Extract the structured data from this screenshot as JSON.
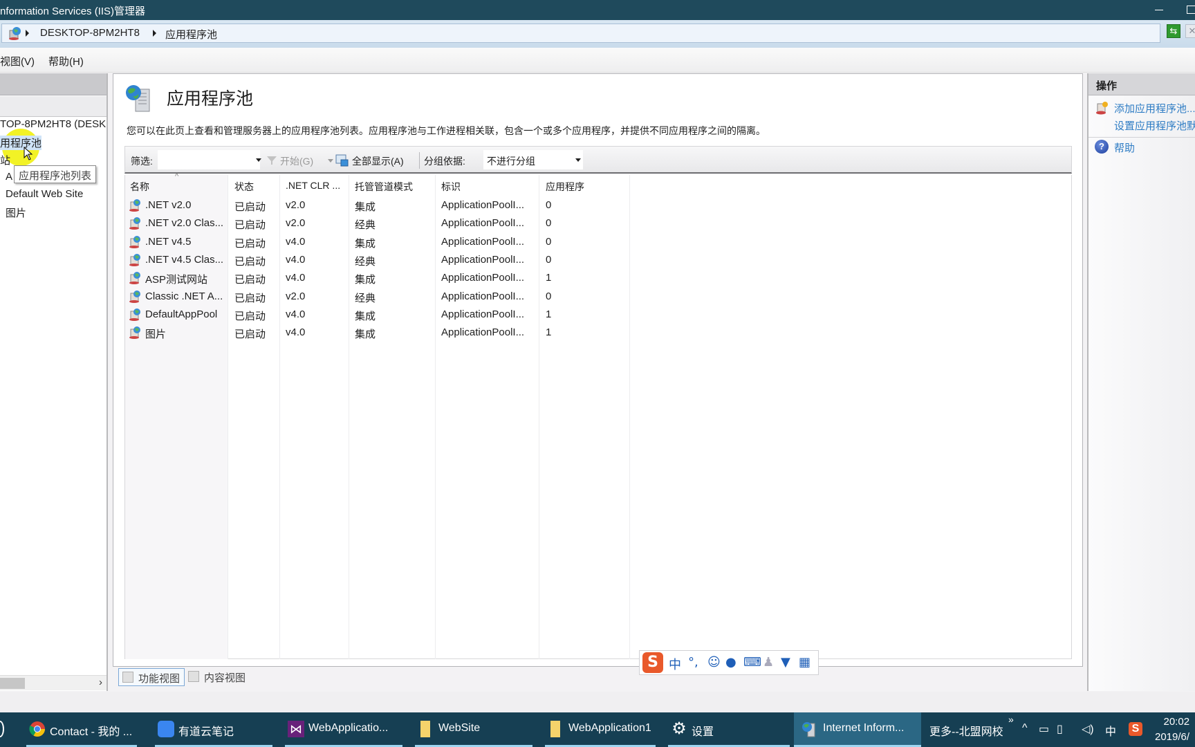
{
  "window": {
    "title": "nformation Services (IIS)管理器"
  },
  "address_bar": {
    "crumbs": [
      "DESKTOP-8PM2HT8",
      "应用程序池"
    ]
  },
  "menu": {
    "items": [
      "视图(V)",
      "帮助(H)"
    ]
  },
  "connections": {
    "tree": [
      {
        "label": "TOP-8PM2HT8 (DESK"
      },
      {
        "label": "用程序池",
        "selected": true
      },
      {
        "label": "站"
      },
      {
        "label": "A"
      },
      {
        "label": "Default Web Site"
      },
      {
        "label": "图片"
      }
    ],
    "tooltip": "应用程序池列表"
  },
  "main": {
    "title": "应用程序池",
    "description": "您可以在此页上查看和管理服务器上的应用程序池列表。应用程序池与工作进程相关联，包含一个或多个应用程序，并提供不同应用程序之间的隔离。",
    "filter": {
      "label": "筛选:",
      "value": "",
      "go_label": "开始(G)",
      "show_all_label": "全部显示(A)",
      "group_label": "分组依据:",
      "group_value": "不进行分组"
    },
    "columns": [
      "名称",
      "状态",
      ".NET CLR ...",
      "托管管道模式",
      "标识",
      "应用程序"
    ],
    "rows": [
      {
        "name": ".NET v2.0",
        "status": "已启动",
        "clr": "v2.0",
        "pipeline": "集成",
        "identity": "ApplicationPoolI...",
        "apps": "0"
      },
      {
        "name": ".NET v2.0 Clas...",
        "status": "已启动",
        "clr": "v2.0",
        "pipeline": "经典",
        "identity": "ApplicationPoolI...",
        "apps": "0"
      },
      {
        "name": ".NET v4.5",
        "status": "已启动",
        "clr": "v4.0",
        "pipeline": "集成",
        "identity": "ApplicationPoolI...",
        "apps": "0"
      },
      {
        "name": ".NET v4.5 Clas...",
        "status": "已启动",
        "clr": "v4.0",
        "pipeline": "经典",
        "identity": "ApplicationPoolI...",
        "apps": "0"
      },
      {
        "name": "ASP测试网站",
        "status": "已启动",
        "clr": "v4.0",
        "pipeline": "集成",
        "identity": "ApplicationPoolI...",
        "apps": "1"
      },
      {
        "name": "Classic .NET A...",
        "status": "已启动",
        "clr": "v2.0",
        "pipeline": "经典",
        "identity": "ApplicationPoolI...",
        "apps": "0"
      },
      {
        "name": "DefaultAppPool",
        "status": "已启动",
        "clr": "v4.0",
        "pipeline": "集成",
        "identity": "ApplicationPoolI...",
        "apps": "1"
      },
      {
        "name": "图片",
        "status": "已启动",
        "clr": "v4.0",
        "pipeline": "集成",
        "identity": "ApplicationPoolI...",
        "apps": "1"
      }
    ],
    "view_tabs": [
      "功能视图",
      "内容视图"
    ]
  },
  "actions": {
    "header": "操作",
    "items": [
      "添加应用程序池...",
      "设置应用程序池默认设置...",
      "帮助"
    ]
  },
  "ime": {
    "logo": "S",
    "items": [
      "中",
      "°,",
      "☺",
      "🎤",
      "⌨",
      "👤",
      "👕",
      "▦"
    ]
  },
  "taskbar": {
    "tasks": [
      {
        "label": "Contact - 我的 ...",
        "icon": "chrome-icon"
      },
      {
        "label": "有道云笔记",
        "icon": "youdao-note-icon"
      },
      {
        "label": "WebApplicatio...",
        "icon": "visual-studio-icon"
      },
      {
        "label": "WebSite",
        "icon": "folder-icon"
      },
      {
        "label": "WebApplication1",
        "icon": "folder-icon"
      },
      {
        "label": "设置",
        "icon": "gear-icon"
      },
      {
        "label": "Internet Inform...",
        "icon": "iis-icon",
        "active": true
      }
    ],
    "more_label": "更多--北盟网校",
    "chevron": "»",
    "ime_lang": "中",
    "time": "20:02",
    "date": "2019/6/"
  },
  "colors": {
    "titlebar": "#1f4a5c",
    "taskbar": "#163f53",
    "link": "#2e7cc4",
    "selection": "#cfe3f7"
  }
}
